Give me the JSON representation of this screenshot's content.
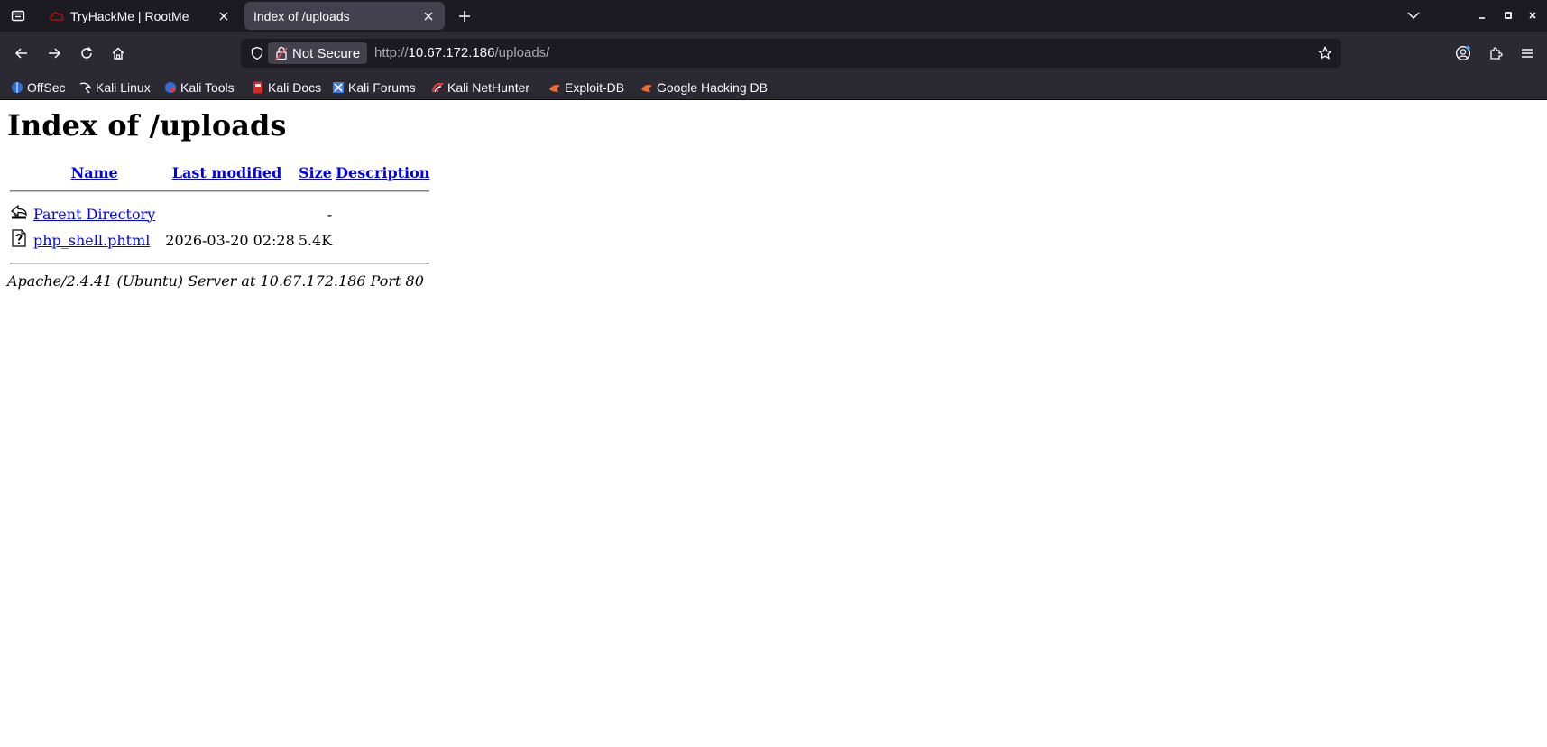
{
  "browser": {
    "tabs": [
      {
        "title": "TryHackMe | RootMe",
        "active": false,
        "favicon": "tryhackme-icon"
      },
      {
        "title": "Index of /uploads",
        "active": true,
        "favicon": ""
      }
    ],
    "security_label": "Not Secure",
    "url": {
      "scheme": "http://",
      "host": "10.67.172.186",
      "path": "/uploads/"
    },
    "bookmarks": [
      {
        "label": "OffSec",
        "icon": "offsec-icon"
      },
      {
        "label": "Kali Linux",
        "icon": "kali-dragon-icon"
      },
      {
        "label": "Kali Tools",
        "icon": "kali-tools-icon"
      },
      {
        "label": "Kali Docs",
        "icon": "kali-docs-icon"
      },
      {
        "label": "Kali Forums",
        "icon": "kali-forums-icon"
      },
      {
        "label": "Kali NetHunter",
        "icon": "nethunter-icon"
      },
      {
        "label": "Exploit-DB",
        "icon": "exploitdb-icon"
      },
      {
        "label": "Google Hacking DB",
        "icon": "ghdb-icon"
      }
    ],
    "colors": {
      "tabbar": "#1c1b22",
      "toolbar": "#2b2a33",
      "active_tab": "#42414d",
      "link": "#0000ee"
    }
  },
  "page": {
    "heading": "Index of /uploads",
    "columns": {
      "name": "Name",
      "modified": "Last modified",
      "size": "Size",
      "description": "Description"
    },
    "rows": [
      {
        "icon": "back-folder-icon",
        "name": "Parent Directory",
        "modified": "",
        "size": "-",
        "description": ""
      },
      {
        "icon": "unknown-file-icon",
        "name": "php_shell.phtml",
        "modified": "2026-03-20 02:28",
        "size": "5.4K",
        "description": ""
      }
    ],
    "footer": "Apache/2.4.41 (Ubuntu) Server at 10.67.172.186 Port 80"
  }
}
